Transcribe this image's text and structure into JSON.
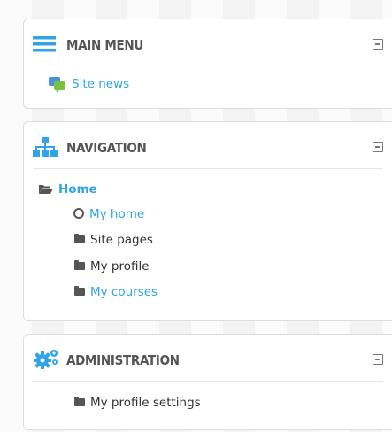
{
  "main_menu": {
    "title": "MAIN MENU",
    "items": [
      {
        "label": "Site news",
        "icon": "forum-icon"
      }
    ]
  },
  "navigation": {
    "title": "NAVIGATION",
    "home": "Home",
    "items": [
      {
        "label": "My home",
        "icon": "circle-icon"
      },
      {
        "label": "Site pages",
        "icon": "folder-icon"
      },
      {
        "label": "My profile",
        "icon": "folder-icon"
      },
      {
        "label": "My courses",
        "icon": "folder-icon"
      }
    ]
  },
  "administration": {
    "title": "ADMINISTRATION",
    "items": [
      {
        "label": "My profile settings",
        "icon": "folder-icon"
      }
    ]
  },
  "colors": {
    "accent": "#2fa4e7",
    "text": "#333333",
    "header_text": "#555555"
  }
}
